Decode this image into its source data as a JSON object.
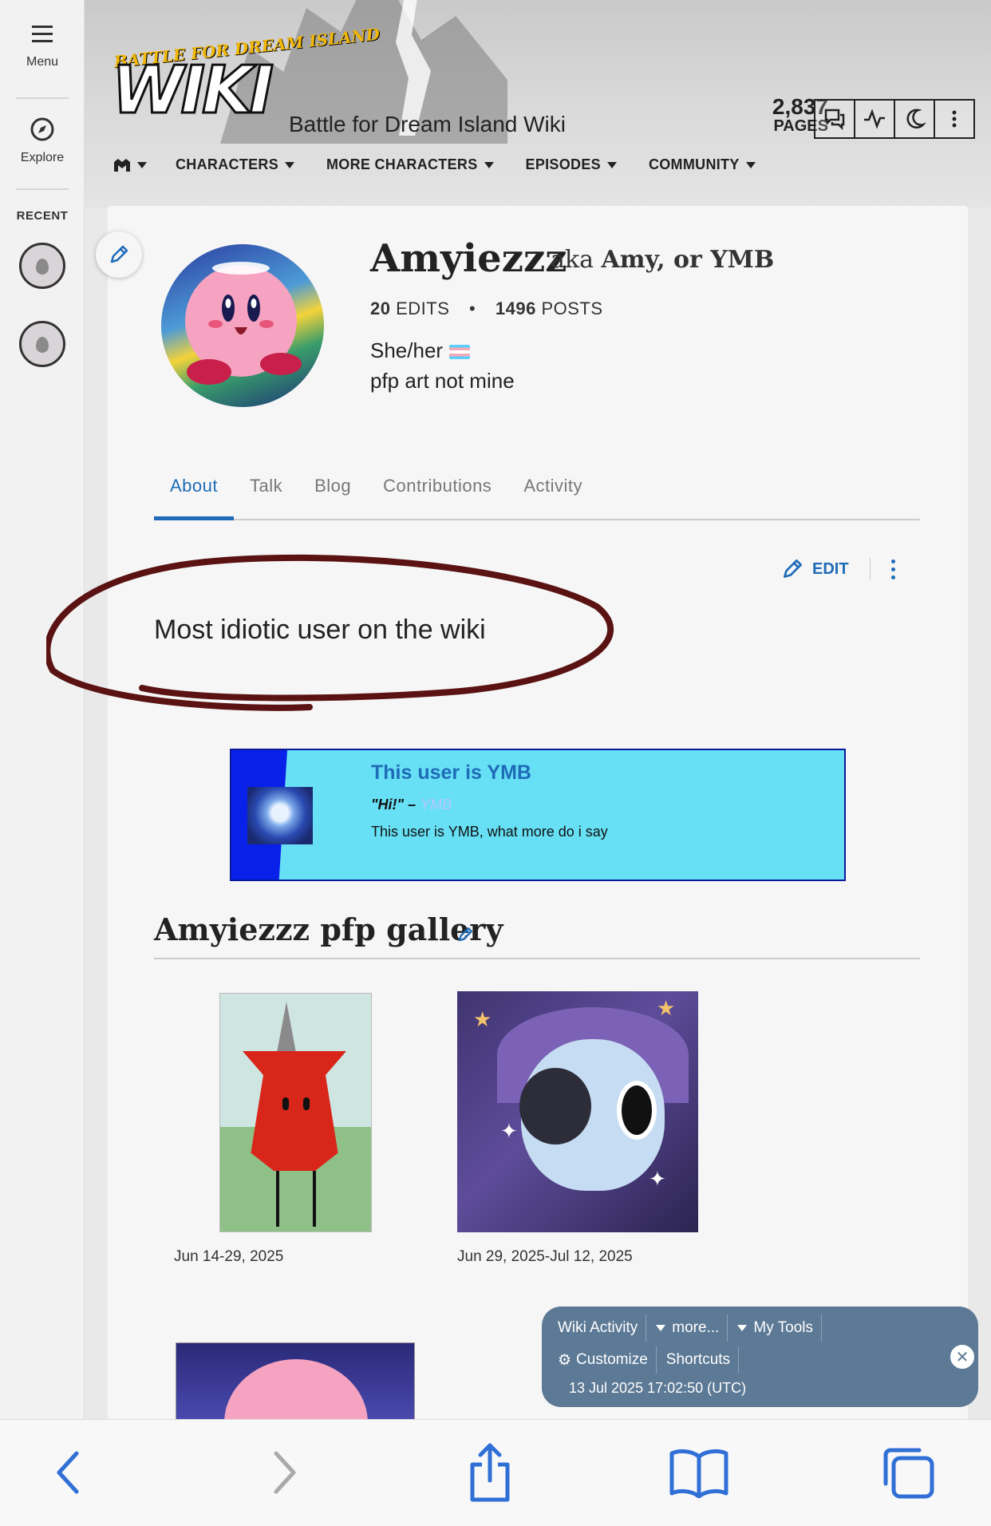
{
  "rail": {
    "menu_label": "Menu",
    "explore_label": "Explore",
    "recent_label": "RECENT"
  },
  "header": {
    "logo_top": "BATTLE FOR DREAM ISLAND",
    "logo_main": "WIKI",
    "site_title": "Battle for Dream Island Wiki",
    "pages_count": "2,837",
    "pages_label": "PAGES",
    "nav": [
      {
        "label": "CHARACTERS"
      },
      {
        "label": "MORE CHARACTERS"
      },
      {
        "label": "EPISODES"
      },
      {
        "label": "COMMUNITY"
      }
    ]
  },
  "profile": {
    "username": "Amyiezzz",
    "aka_prefix": "aka",
    "aka": "Amy, or YMB",
    "edits_count": "20",
    "edits_label": "EDITS",
    "posts_count": "1496",
    "posts_label": "POSTS",
    "bio_line1": "She/her",
    "bio_line2": "pfp art not mine"
  },
  "tabs": [
    {
      "label": "About",
      "active": true
    },
    {
      "label": "Talk"
    },
    {
      "label": "Blog"
    },
    {
      "label": "Contributions"
    },
    {
      "label": "Activity"
    }
  ],
  "about": {
    "edit_label": "EDIT",
    "text": "Most idiotic user on the wiki"
  },
  "userbox": {
    "title": "This user is YMB",
    "quote": "\"Hi!\" –",
    "quote_author": "YMB",
    "description": "This user is YMB, what more do i say"
  },
  "gallery": {
    "title": "Amyiezzz pfp gallery",
    "captions": [
      "Jun 14-29, 2025",
      "Jun 29, 2025-Jul 12, 2025"
    ]
  },
  "wikibar": {
    "wiki_activity": "Wiki Activity",
    "more": "more...",
    "my_tools": "My Tools",
    "customize": "Customize",
    "shortcuts": "Shortcuts",
    "timestamp": "13 Jul 2025 17:02:50 (UTC)"
  },
  "colors": {
    "accent": "#1e6bb8",
    "userbox_bg": "#67e0f5",
    "userbox_left": "#0820e8",
    "toolbar_bg": "#5c7995",
    "scribble": "#5a1212"
  },
  "icons": {
    "browser_toolbar": [
      "back-icon",
      "forward-icon",
      "share-icon",
      "bookmarks-icon",
      "tabs-icon"
    ]
  }
}
